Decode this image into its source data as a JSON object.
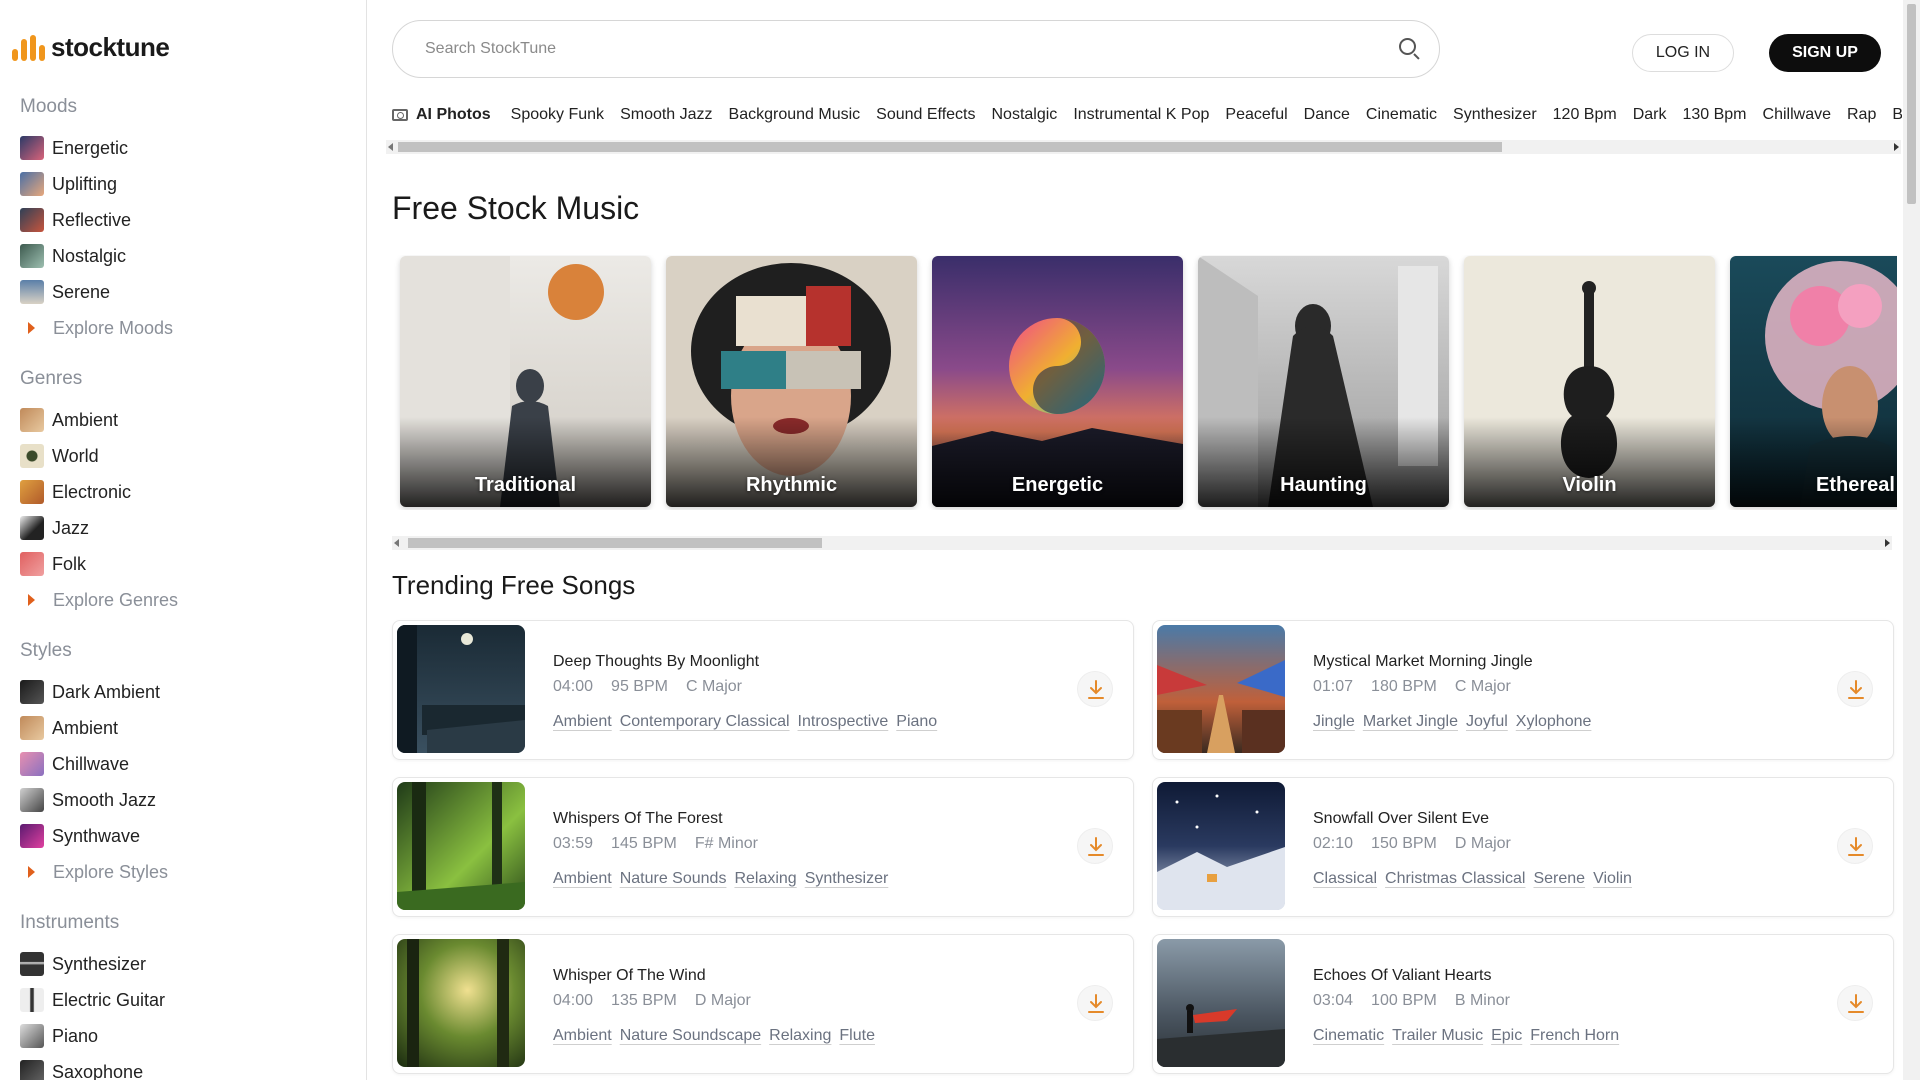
{
  "brand": {
    "name": "stocktune",
    "accent": "#f0961c"
  },
  "sidebar": {
    "sections": [
      {
        "heading": "Moods",
        "items": [
          {
            "label": "Energetic"
          },
          {
            "label": "Uplifting"
          },
          {
            "label": "Reflective"
          },
          {
            "label": "Nostalgic"
          },
          {
            "label": "Serene"
          }
        ],
        "explore": "Explore Moods"
      },
      {
        "heading": "Genres",
        "items": [
          {
            "label": "Ambient"
          },
          {
            "label": "World"
          },
          {
            "label": "Electronic"
          },
          {
            "label": "Jazz"
          },
          {
            "label": "Folk"
          }
        ],
        "explore": "Explore Genres"
      },
      {
        "heading": "Styles",
        "items": [
          {
            "label": "Dark Ambient"
          },
          {
            "label": "Ambient"
          },
          {
            "label": "Chillwave"
          },
          {
            "label": "Smooth Jazz"
          },
          {
            "label": "Synthwave"
          }
        ],
        "explore": "Explore Styles"
      },
      {
        "heading": "Instruments",
        "items": [
          {
            "label": "Synthesizer"
          },
          {
            "label": "Electric Guitar"
          },
          {
            "label": "Piano"
          },
          {
            "label": "Saxophone"
          }
        ]
      }
    ]
  },
  "header": {
    "search_placeholder": "Search StockTune",
    "login_label": "LOG IN",
    "signup_label": "SIGN UP"
  },
  "chips": {
    "ai_label": "AI Photos",
    "items": [
      "Spooky Funk",
      "Smooth Jazz",
      "Background Music",
      "Sound Effects",
      "Nostalgic",
      "Instrumental K Pop",
      "Peaceful",
      "Dance",
      "Cinematic",
      "Synthesizer",
      "120 Bpm",
      "Dark",
      "130 Bpm",
      "Chillwave",
      "Rap",
      "Bo"
    ]
  },
  "free_music": {
    "heading": "Free Stock Music",
    "cards": [
      {
        "label": "Traditional"
      },
      {
        "label": "Rhythmic"
      },
      {
        "label": "Energetic"
      },
      {
        "label": "Haunting"
      },
      {
        "label": "Violin"
      },
      {
        "label": "Ethereal"
      }
    ]
  },
  "trending": {
    "heading": "Trending Free Songs",
    "songs": [
      {
        "title": "Deep Thoughts By Moonlight",
        "duration": "04:00",
        "bpm": "95 BPM",
        "key": "C Major",
        "tags": [
          "Ambient",
          "Contemporary Classical",
          "Introspective",
          "Piano"
        ]
      },
      {
        "title": "Mystical Market Morning Jingle",
        "duration": "01:07",
        "bpm": "180 BPM",
        "key": "C Major",
        "tags": [
          "Jingle",
          "Market Jingle",
          "Joyful",
          "Xylophone"
        ]
      },
      {
        "title": "Whispers Of The Forest",
        "duration": "03:59",
        "bpm": "145 BPM",
        "key": "F# Minor",
        "tags": [
          "Ambient",
          "Nature Sounds",
          "Relaxing",
          "Synthesizer"
        ]
      },
      {
        "title": "Snowfall Over Silent Eve",
        "duration": "02:10",
        "bpm": "150 BPM",
        "key": "D Major",
        "tags": [
          "Classical",
          "Christmas Classical",
          "Serene",
          "Violin"
        ]
      },
      {
        "title": "Whisper Of The Wind",
        "duration": "04:00",
        "bpm": "135 BPM",
        "key": "D Major",
        "tags": [
          "Ambient",
          "Nature Soundscape",
          "Relaxing",
          "Flute"
        ]
      },
      {
        "title": "Echoes Of Valiant Hearts",
        "duration": "03:04",
        "bpm": "100 BPM",
        "key": "B Minor",
        "tags": [
          "Cinematic",
          "Trailer Music",
          "Epic",
          "French Horn"
        ]
      }
    ]
  }
}
